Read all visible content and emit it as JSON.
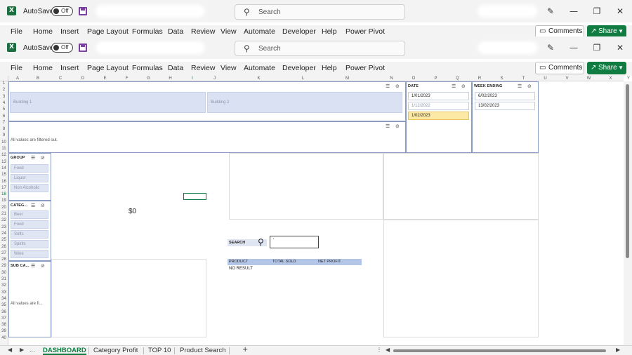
{
  "window1": {
    "autosave_label": "AutoSave",
    "toggle_state": "Off",
    "search_placeholder": "Search"
  },
  "window2": {
    "autosave_label": "AutoSave",
    "toggle_state": "Off",
    "search_placeholder": "Search"
  },
  "menu1": [
    "File",
    "Home",
    "Insert",
    "Page Layout",
    "Formulas",
    "Data",
    "Review",
    "View",
    "Automate",
    "Developer",
    "Help",
    "Power Pivot"
  ],
  "menu2": [
    "File",
    "Home",
    "Insert",
    "Page Layout",
    "Formulas",
    "Data",
    "Review",
    "View",
    "Automate",
    "Developer",
    "Help",
    "Power Pivot"
  ],
  "buttons": {
    "comments": "Comments",
    "share": "Share"
  },
  "columns": [
    "A",
    "B",
    "C",
    "D",
    "E",
    "F",
    "G",
    "H",
    "I",
    "J",
    "K",
    "L",
    "M",
    "N",
    "O",
    "P",
    "Q",
    "R",
    "S",
    "T",
    "U",
    "V",
    "W",
    "X",
    "Y"
  ],
  "selected_column": "I",
  "rows": [
    "1",
    "2",
    "3",
    "4",
    "5",
    "6",
    "7",
    "8",
    "9",
    "10",
    "11",
    "12",
    "13",
    "14",
    "15",
    "16",
    "17",
    "18",
    "19",
    "20",
    "21",
    "22",
    "23",
    "24",
    "25",
    "26",
    "27",
    "28",
    "29",
    "30",
    "31",
    "32",
    "33",
    "34",
    "35",
    "36",
    "37",
    "38",
    "39",
    "40"
  ],
  "selected_row": "18",
  "building_slicer": {
    "items": [
      "Building 1",
      "Building 2"
    ]
  },
  "filtered_msg_top": "All values are filtered out.",
  "date_slicer": {
    "header": "DATE",
    "items": [
      "1/01/2023",
      "1/12/2022",
      "1/02/2023"
    ]
  },
  "week_slicer": {
    "header": "WEEK ENDING",
    "items": [
      "6/02/2023",
      "13/02/2023"
    ]
  },
  "group_slicer": {
    "header": "GROUP",
    "items": [
      "Food",
      "Liquor",
      "Non Alcoholic"
    ]
  },
  "category_slicer": {
    "header": "CATEG...",
    "items": [
      "Beer",
      "Food",
      "Softs",
      "Spirits",
      "Wine"
    ]
  },
  "subcat_slicer": {
    "header": "SUB CA...",
    "message": "All values are fi..."
  },
  "kpi_value": "$0",
  "search": {
    "label": "SEARCH",
    "value": "'"
  },
  "results": {
    "headers": [
      "PRODUCT",
      "TOTAL SOLD",
      "NET PROFIT"
    ],
    "empty": "NO RESULT"
  },
  "sheets": [
    "DASHBOARD",
    "Category Profit",
    "TOP 10",
    "Product Search"
  ],
  "nav": {
    "prev": "◀",
    "next": "▶",
    "more": "...",
    "add": "+"
  },
  "colors": {
    "excel_green": "#107c41",
    "slicer_item": "#dfe5f3",
    "slicer_selected": "#fce9a6",
    "result_header": "#b4c6e7"
  }
}
